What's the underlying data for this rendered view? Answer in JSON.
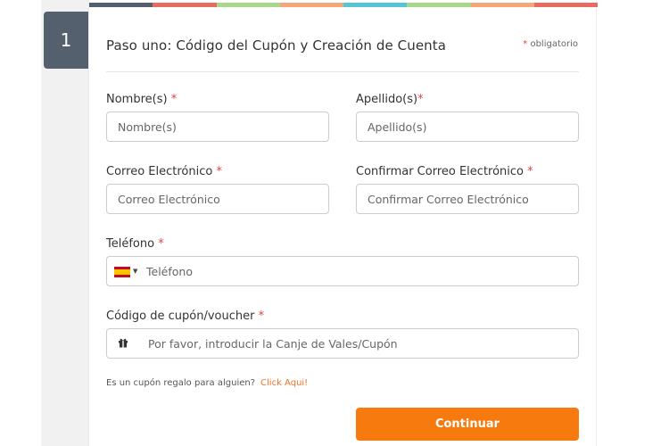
{
  "step": {
    "number": "1"
  },
  "header": {
    "title": "Paso uno: Código del Cupón y Creación de Cuenta",
    "required_note": "obligatorio",
    "required_star": "*"
  },
  "top_bar_colors": [
    "#55606e",
    "#e96a5e",
    "#a8d98a",
    "#f5a77a",
    "#58c4d8",
    "#a8d98a",
    "#f5a77a",
    "#e96a5e"
  ],
  "form": {
    "first_name": {
      "label": "Nombre(s)",
      "star": "*",
      "placeholder": "Nombre(s)"
    },
    "last_name": {
      "label": "Apellido(s)",
      "star": "*",
      "placeholder": "Apellido(s)"
    },
    "email": {
      "label": "Correo Electrónico",
      "star": "*",
      "placeholder": "Correo Electrónico"
    },
    "confirm_email": {
      "label": "Confirmar Correo Electrónico",
      "star": "*",
      "placeholder": "Confirmar Correo Electrónico"
    },
    "phone": {
      "label": "Teléfono",
      "star": "*",
      "placeholder": "Teléfono",
      "country_icon": "spain-flag-icon"
    },
    "coupon": {
      "label": "Código de cupón/voucher",
      "star": "*",
      "placeholder": "Por favor, introducir la Canje de Vales/Cupón",
      "icon": "gift-icon"
    }
  },
  "gift": {
    "text": "Es un cupón regalo para alguien?",
    "link": "Click Aqui!"
  },
  "actions": {
    "continue_label": "Continuar"
  },
  "colors": {
    "accent": "#f77a0f",
    "link": "#f07427",
    "required": "#e2453e",
    "badge": "#55606e"
  }
}
